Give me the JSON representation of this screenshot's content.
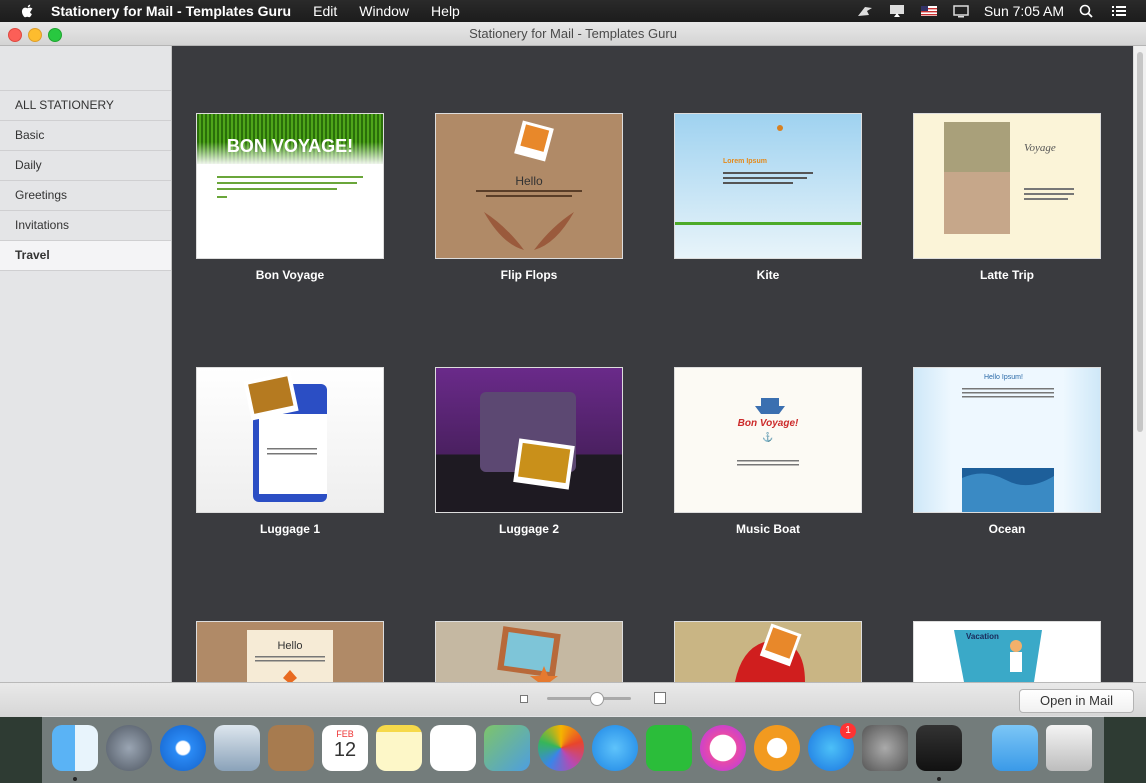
{
  "menubar": {
    "app_name": "Stationery for Mail - Templates Guru",
    "menus": [
      "Edit",
      "Window",
      "Help"
    ],
    "clock": "Sun 7:05 AM"
  },
  "window": {
    "title": "Stationery for Mail - Templates Guru"
  },
  "sidebar": {
    "items": [
      {
        "label": "ALL STATIONERY"
      },
      {
        "label": "Basic"
      },
      {
        "label": "Daily"
      },
      {
        "label": "Greetings"
      },
      {
        "label": "Invitations"
      },
      {
        "label": "Travel"
      }
    ],
    "selected": "Travel"
  },
  "templates": [
    {
      "name": "Bon Voyage",
      "banner_text": "BON VOYAGE!"
    },
    {
      "name": "Flip Flops",
      "heading": "Hello"
    },
    {
      "name": "Kite",
      "heading": "Lorem Ipsum"
    },
    {
      "name": "Latte Trip",
      "heading": "Voyage"
    },
    {
      "name": "Luggage 1"
    },
    {
      "name": "Luggage 2"
    },
    {
      "name": "Music Boat",
      "heading": "Bon Voyage!"
    },
    {
      "name": "Ocean",
      "heading": "Hello Ipsum!"
    },
    {
      "name": "",
      "heading": "Hello"
    },
    {
      "name": ""
    },
    {
      "name": ""
    },
    {
      "name": "",
      "heading": "Vacation"
    }
  ],
  "bottom": {
    "open_button": "Open in Mail",
    "zoom_level": 0.5
  },
  "dock": {
    "apps": [
      "finder",
      "launchpad",
      "safari",
      "mail",
      "contacts",
      "calendar",
      "notes",
      "reminders",
      "maps",
      "photos",
      "messages",
      "facetime",
      "itunes",
      "ibooks",
      "app-store",
      "system-preferences",
      "stationery",
      "downloads",
      "trash"
    ],
    "calendar_month": "FEB",
    "calendar_day": "12",
    "app_store_badge": "1"
  }
}
